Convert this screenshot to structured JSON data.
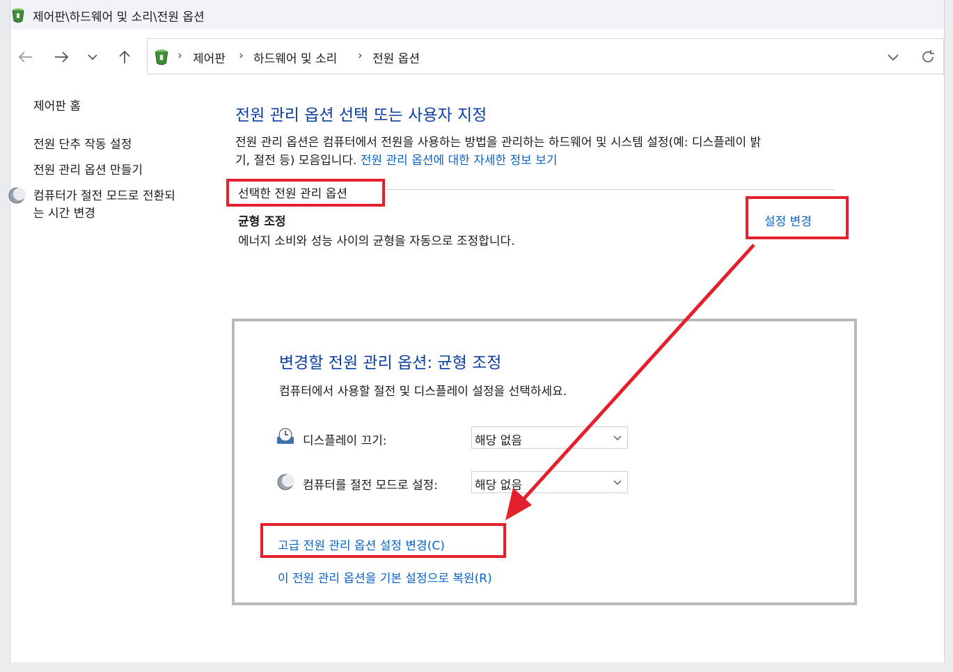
{
  "window": {
    "title": "제어판\\하드웨어 및 소리\\전원 옵션"
  },
  "address_bar": {
    "crumbs": [
      "제어판",
      "하드웨어 및 소리",
      "전원 옵션"
    ],
    "separator": "›"
  },
  "sidebar": {
    "items": [
      {
        "label": "제어판 홈"
      },
      {
        "label": "전원 단추 작동 설정"
      },
      {
        "label": "전원 관리 옵션 만들기"
      },
      {
        "label_line1": "컴퓨터가 절전 모드로 전환되",
        "label_line2": "는 시간 변경",
        "icon": "sleep-moon-icon"
      }
    ]
  },
  "main": {
    "title": "전원 관리 옵션 선택 또는 사용자 지정",
    "description_line1": "전원 관리 옵션은 컴퓨터에서 전원을 사용하는 방법을 관리하는 하드웨어 및 시스템 설정(예: 디스플레이 밝",
    "description_line2_prefix": "기, 절전 등) 모음입니다. ",
    "description_link": "전원 관리 옵션에 대한 자세한 정보 보기",
    "selected_group_label": "선택한 전원 관리 옵션",
    "plan_name": "균형 조정",
    "plan_description": "에너지 소비와 성능 사이의 균형을 자동으로 조정합니다.",
    "change_settings_link": "설정 변경"
  },
  "edit_panel": {
    "title": "변경할 전원 관리 옵션: 균형 조정",
    "description": "컴퓨터에서 사용할 절전 및 디스플레이 설정을 선택하세요.",
    "settings": [
      {
        "label": "디스플레이 끄기:",
        "value": "해당 없음",
        "icon": "display-clock-icon"
      },
      {
        "label": "컴퓨터를 절전 모드로 설정:",
        "value": "해당 없음",
        "icon": "sleep-moon-icon"
      }
    ],
    "advanced_link": "고급 전원 관리 옵션 설정 변경(C)",
    "restore_link": "이 전원 관리 옵션을 기본 설정으로 복원(R)"
  },
  "colors": {
    "accent_title": "#0a3ea4",
    "link": "#0a62c6",
    "highlight": "#e3202c"
  }
}
